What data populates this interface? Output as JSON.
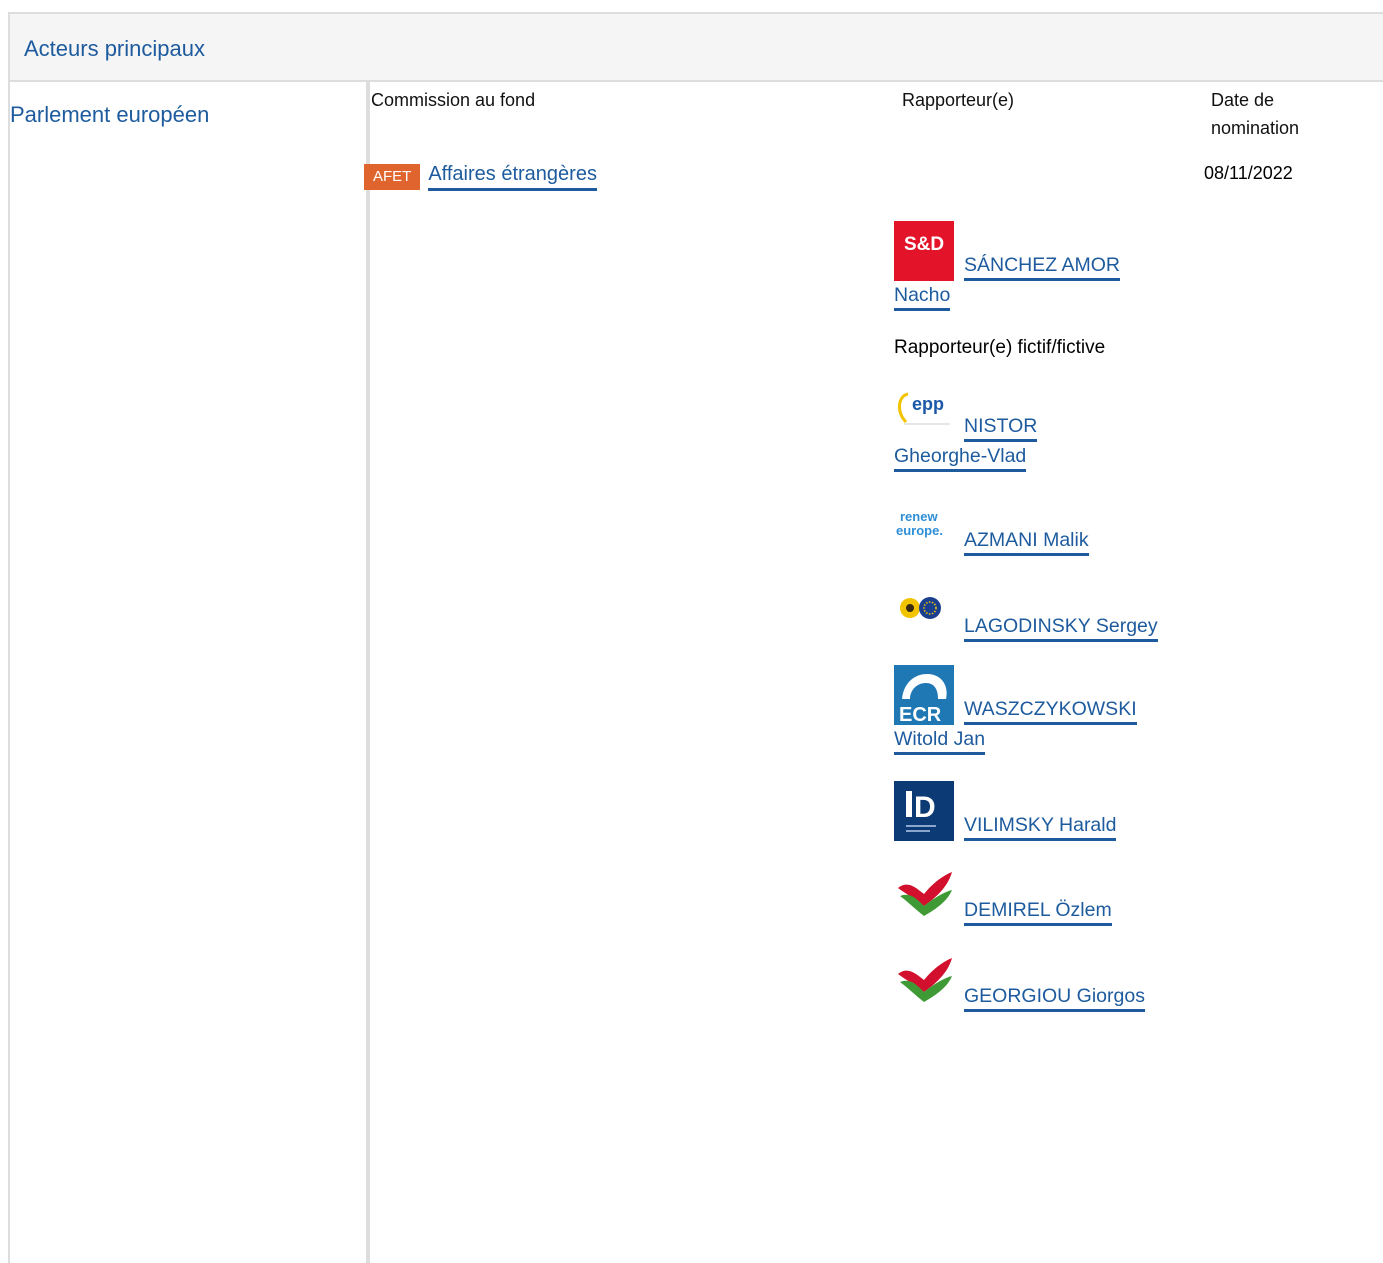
{
  "panel": {
    "title": "Acteurs principaux"
  },
  "institution": "Parlement européen",
  "columns": {
    "committee": "Commission au fond",
    "rapporteur": "Rapporteur(e)",
    "date_line1": "Date de",
    "date_line2": "nomination"
  },
  "committee": {
    "badge": "AFET",
    "name": "Affaires étrangères",
    "date": "08/11/2022"
  },
  "rapporteur": {
    "party_logo": "S&D",
    "name_line1": "SÁNCHEZ AMOR",
    "name_line2": "Nacho"
  },
  "shadow_label": "Rapporteur(e) fictif/fictive",
  "shadows": [
    {
      "party_logo": "epp",
      "name_line1": "NISTOR",
      "name_line2": "Gheorghe-Vlad"
    },
    {
      "party_logo_line1": "renew",
      "party_logo_line2": "europe.",
      "name_line1": "AZMANI Malik"
    },
    {
      "party_logo": "greens-efa-icon",
      "name_line1": "LAGODINSKY Sergey"
    },
    {
      "party_logo": "ECR",
      "name_line1": "WASZCZYKOWSKI",
      "name_line2": "Witold Jan"
    },
    {
      "party_logo": "D",
      "name_line1": "VILIMSKY Harald"
    },
    {
      "party_logo": "left-icon",
      "name_line1": "DEMIREL Özlem"
    },
    {
      "party_logo": "left-icon",
      "name_line1": "GEORGIOU Giorgos"
    }
  ],
  "colors": {
    "link": "#1d5b9e",
    "badge": "#e0642d",
    "border": "#dddddd",
    "header_bg": "#f5f5f5"
  }
}
